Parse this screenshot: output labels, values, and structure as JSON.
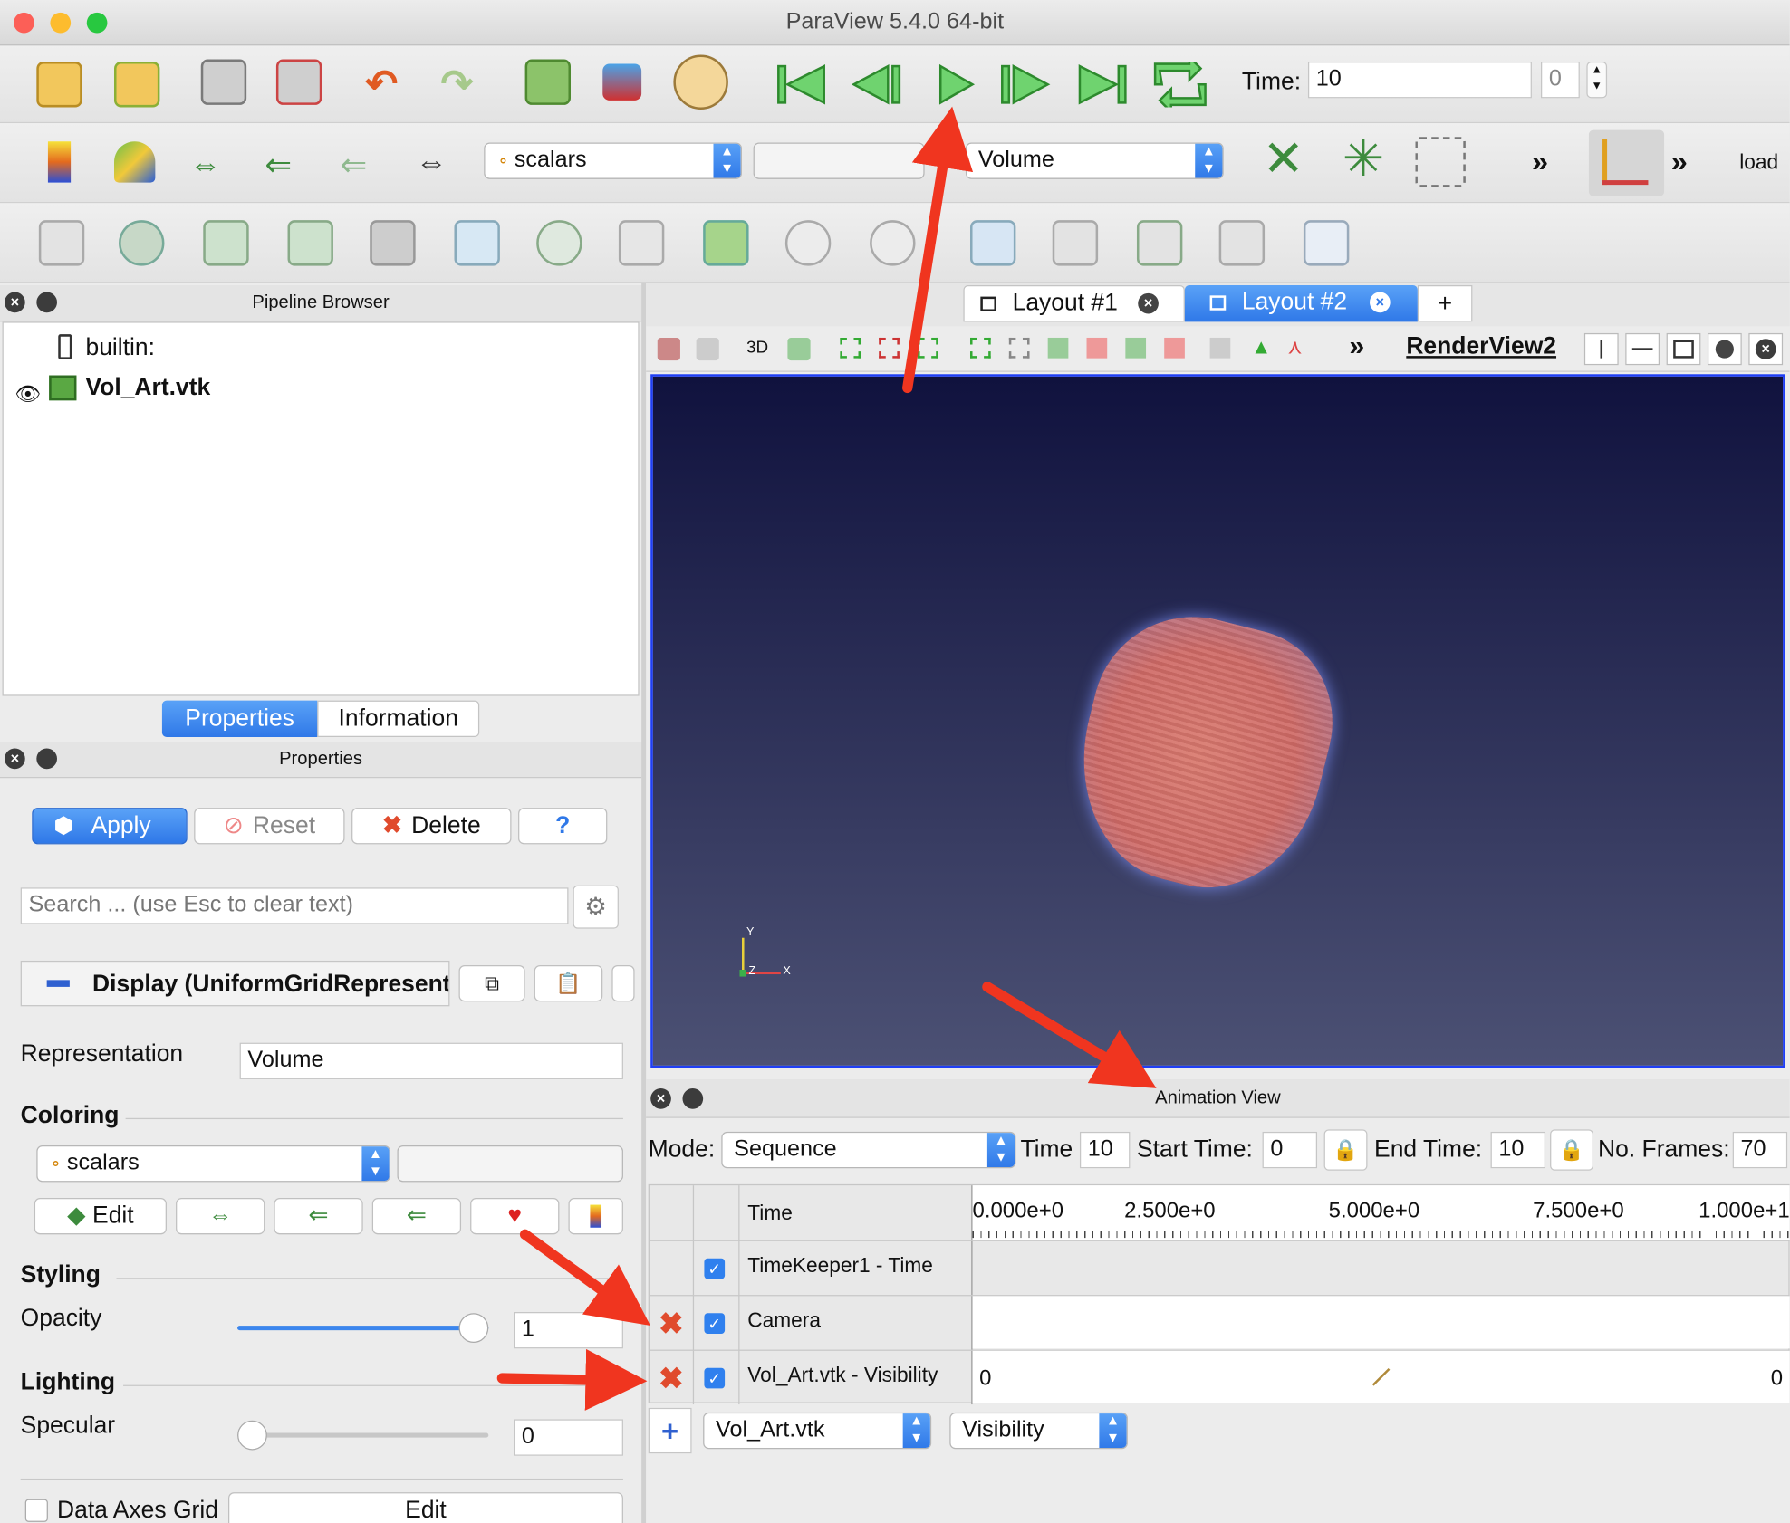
{
  "window": {
    "title": "ParaView 5.4.0 64-bit"
  },
  "toolbar": {
    "time_label": "Time:",
    "time_value": "10",
    "time_index": "0",
    "color_array": "scalars",
    "component": "",
    "representation": "Volume",
    "overflow_glyph": "»",
    "load_label": "load",
    "icons": [
      "open-icon",
      "load-state-icon",
      "connect-icon",
      "disconnect-icon",
      "undo-icon",
      "redo-icon",
      "reset-session-icon",
      "save-screenshot-icon",
      "color-palette-icon",
      "first-frame-icon",
      "previous-frame-icon",
      "play-icon",
      "next-frame-icon",
      "last-frame-icon",
      "loop-icon"
    ]
  },
  "pipeline": {
    "title": "Pipeline Browser",
    "items": [
      {
        "label": "builtin:"
      },
      {
        "label": "Vol_Art.vtk"
      }
    ]
  },
  "tabs": {
    "properties": "Properties",
    "information": "Information"
  },
  "properties": {
    "title": "Properties",
    "apply": "Apply",
    "reset": "Reset",
    "delete": "Delete",
    "help": "?",
    "search_placeholder": "Search ... (use Esc to clear text)",
    "display_header": "Display (UniformGridRepresentation)",
    "representation_label": "Representation",
    "representation_value": "Volume",
    "coloring_label": "Coloring",
    "coloring_value": "scalars",
    "edit_label": "Edit",
    "styling_label": "Styling",
    "opacity_label": "Opacity",
    "opacity_value": "1",
    "opacity_level": 1.0,
    "lighting_label": "Lighting",
    "specular_label": "Specular",
    "specular_value": "0",
    "specular_level": 0.0,
    "data_axes_grid_label": "Data Axes Grid",
    "data_axes_grid_edit": "Edit"
  },
  "layouts": {
    "tabs": [
      "Layout #1",
      "Layout #2"
    ],
    "add": "+"
  },
  "render_view": {
    "title": "RenderView2",
    "label_3d": "3D",
    "axis_y": "Y",
    "axis_x": "X",
    "axis_z": "Z",
    "background_top": "#10123e",
    "background_bottom": "#4c5174"
  },
  "animation": {
    "title": "Animation View",
    "mode_label": "Mode:",
    "mode_value": "Sequence",
    "time_label": "Time",
    "time_value": "10",
    "start_label": "Start Time:",
    "start_value": "0",
    "end_label": "End Time:",
    "end_value": "10",
    "frames_label": "No. Frames:",
    "frames_value": "70",
    "timeline_header": "Time",
    "ticks": [
      "0.000e+0",
      "2.500e+0",
      "5.000e+0",
      "7.500e+0",
      "1.000e+1"
    ],
    "tracks": [
      {
        "label": "TimeKeeper1 - Time",
        "deletable": false,
        "checked": true
      },
      {
        "label": "Camera",
        "deletable": true,
        "checked": true
      },
      {
        "label": "Vol_Art.vtk - Visibility",
        "deletable": true,
        "checked": true,
        "start_value": "0",
        "end_value": "0"
      }
    ],
    "add_source": "Vol_Art.vtk",
    "add_property": "Visibility"
  }
}
